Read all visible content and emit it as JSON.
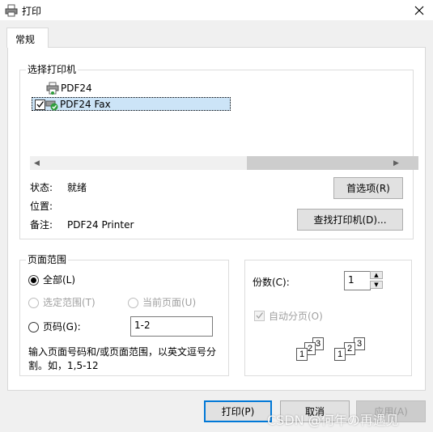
{
  "window": {
    "title": "打印",
    "close_glyph": "✕"
  },
  "tabs": [
    {
      "label": "常规"
    }
  ],
  "select_printer": {
    "title": "选择打印机",
    "printers": [
      {
        "name": "PDF24",
        "selected": false
      },
      {
        "name": "PDF24 Fax",
        "selected": true
      }
    ]
  },
  "status": {
    "status_label": "状态:",
    "status_value": "就绪",
    "location_label": "位置:",
    "location_value": "",
    "comment_label": "备注:",
    "comment_value": "PDF24 Printer",
    "preferences_button": "首选项(R)",
    "find_printer_button": "查找打印机(D)..."
  },
  "page_range": {
    "title": "页面范围",
    "all": "全部(L)",
    "selection": "选定范围(T)",
    "current_page": "当前页面(U)",
    "pages": "页码(G):",
    "pages_value": "1-2",
    "hint": "输入页面号码和/或页面范围，以英文逗号分割。如，1,5-12",
    "selected_option": "all"
  },
  "copies": {
    "label": "份数(C):",
    "value": "1",
    "collate_label": "自动分页(O)",
    "collate_checked": true
  },
  "buttons": {
    "print": "打印(P)",
    "cancel": "取消",
    "apply": "应用(A)"
  },
  "watermark": "CSDN @何年の再遇见"
}
